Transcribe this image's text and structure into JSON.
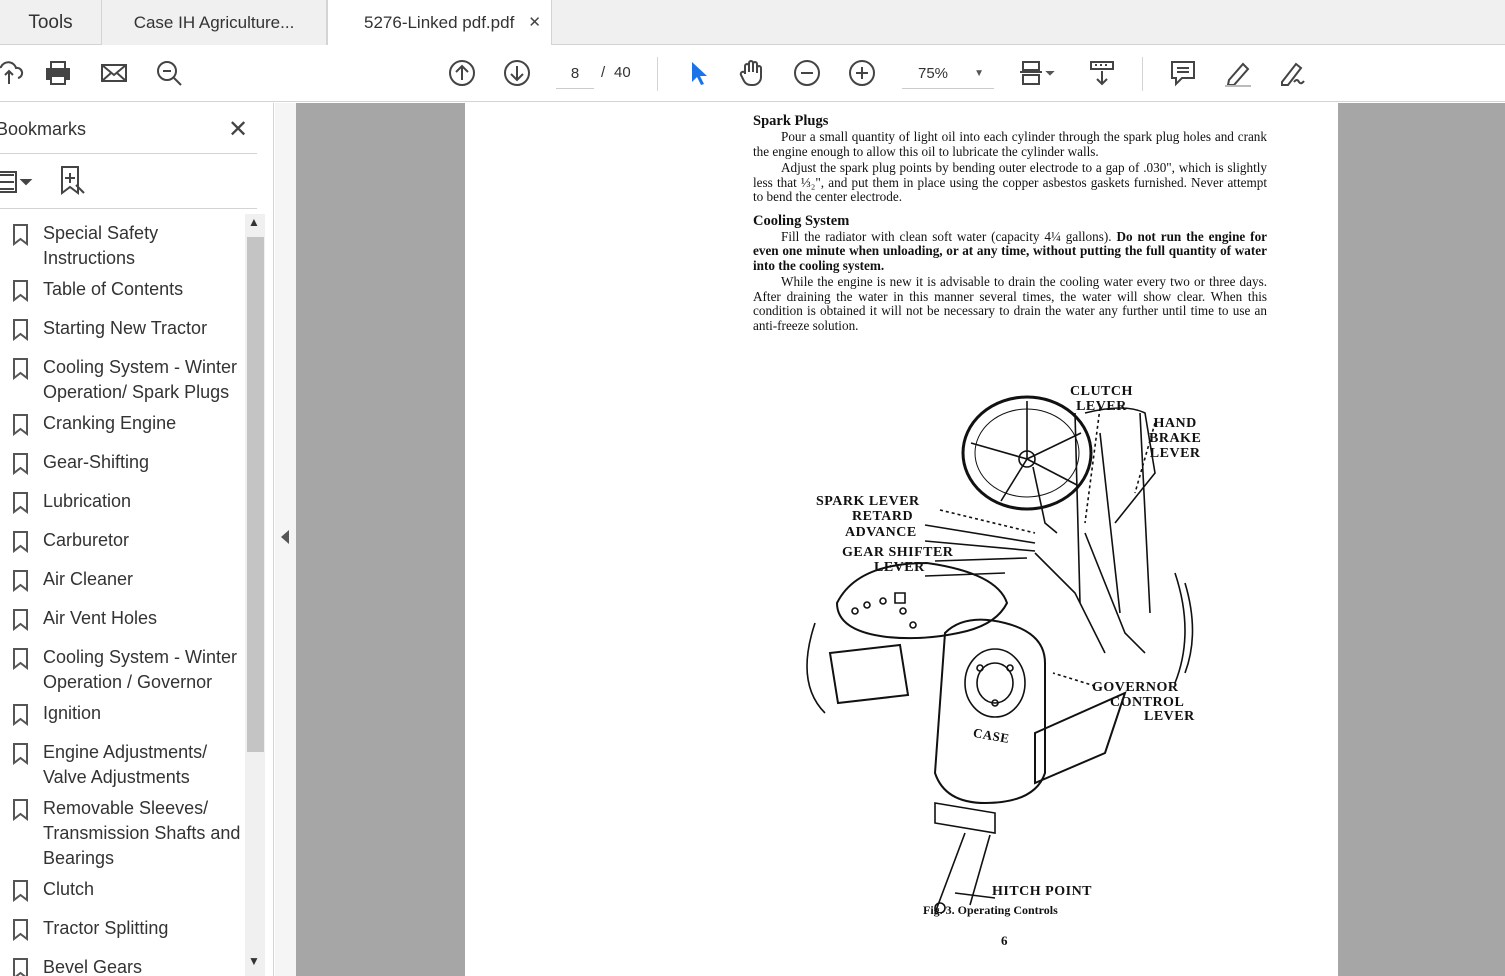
{
  "tabs": {
    "tools": "Tools",
    "tab1": "Case IH Agriculture...",
    "tab2": "5276-Linked pdf.pdf",
    "close": "✕"
  },
  "toolbar": {
    "page_current": "8",
    "page_sep": "/",
    "page_total": "40",
    "zoom": "75%"
  },
  "bookmarks": {
    "title": "Bookmarks",
    "close": "✕",
    "items": [
      {
        "label": "Special Safety Instructions"
      },
      {
        "label": "Table of Contents"
      },
      {
        "label": "Starting New Tractor"
      },
      {
        "label": "Cooling System - Winter Operation/ Spark Plugs"
      },
      {
        "label": "Cranking Engine"
      },
      {
        "label": "Gear-Shifting"
      },
      {
        "label": "Lubrication"
      },
      {
        "label": "Carburetor"
      },
      {
        "label": "Air Cleaner"
      },
      {
        "label": "Air Vent Holes"
      },
      {
        "label": "Cooling System - Winter Operation / Governor"
      },
      {
        "label": "Ignition"
      },
      {
        "label": "Engine Adjustments/ Valve Adjustments"
      },
      {
        "label": "Removable Sleeves/ Transmission Shafts and Bearings"
      },
      {
        "label": "Clutch"
      },
      {
        "label": "Tractor Splitting"
      },
      {
        "label": "Bevel Gears"
      }
    ]
  },
  "document": {
    "h1": "Spark Plugs",
    "p1": "Pour a small quantity of light oil into each cylinder through the spark plug holes and crank the engine enough to allow this oil to lubricate the cylinder walls.",
    "p2": "Adjust the spark plug points by bending outer electrode to a gap of .030\", which is slightly less that ⅓₂\", and put them in place using the copper asbestos gaskets furnished. Never attempt to bend the center electrode.",
    "h2": "Cooling System",
    "p3a": "Fill the radiator with clean soft water (capacity 4¼ gallons).",
    "p3b": "Do not run the engine for even one minute when unloading, or at any time, without putting the full quantity of water into the cooling system.",
    "p4": "While the engine is new it is advisable to drain the cooling water every two or three days. After draining the water in this manner several times, the water will show clear. When this condition is obtained it will not be necessary to drain the water any further until time to use an anti-freeze solution.",
    "labels": {
      "clutch": "CLUTCH LEVER",
      "clutch1": "CLUTCH",
      "clutch2": "LEVER",
      "hand1": "HAND",
      "hand2": "BRAKE",
      "hand3": "LEVER",
      "spark1": "SPARK LEVER",
      "spark2": "RETARD",
      "spark3": "ADVANCE",
      "gear1": "GEAR SHIFTER",
      "gear2": "LEVER",
      "gov1": "GOVERNOR",
      "gov2": "CONTROL",
      "gov3": "LEVER",
      "hitch": "HITCH POINT",
      "case": "CASE"
    },
    "caption": "Fig. 3.   Operating Controls",
    "pagenum": "6"
  }
}
